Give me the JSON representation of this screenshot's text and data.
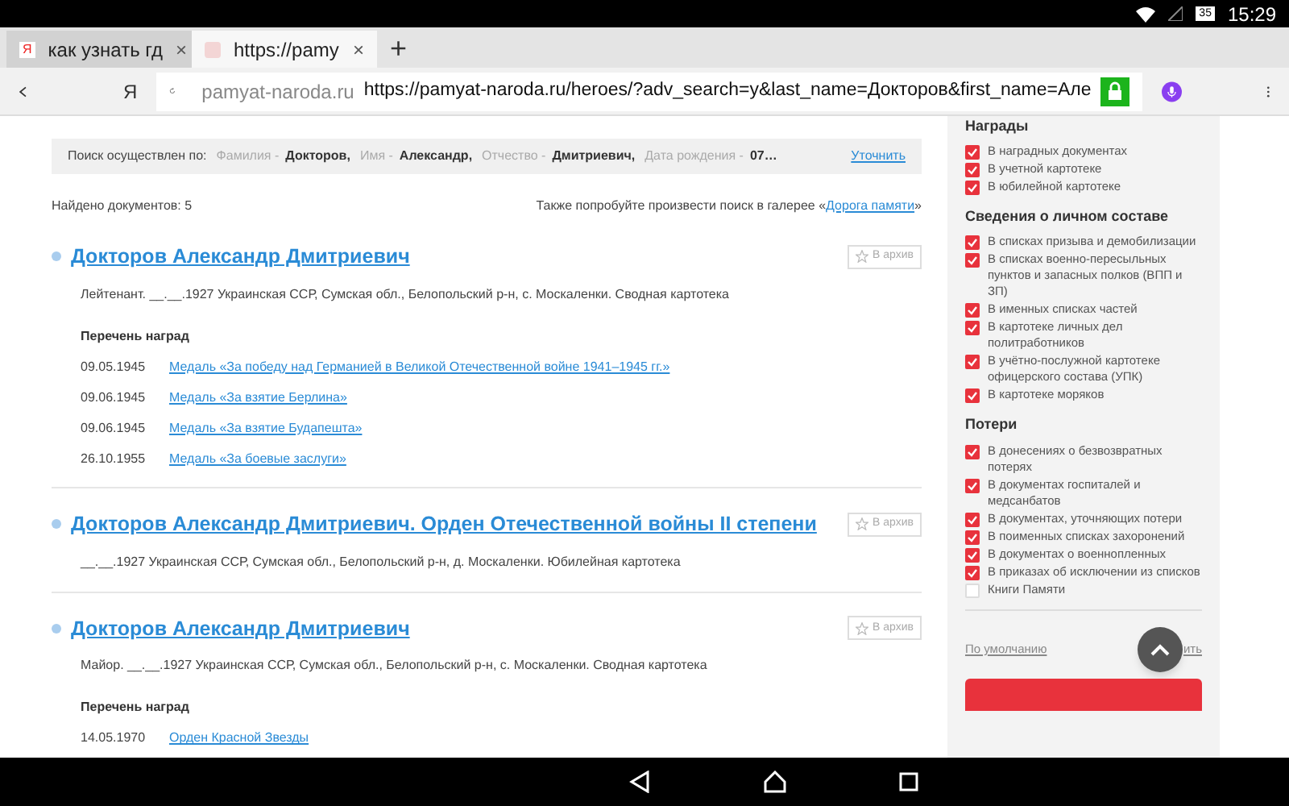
{
  "status_bar": {
    "battery": "35",
    "time": "15:29"
  },
  "tabs": [
    {
      "label": "как узнать гд",
      "selected": false,
      "favicon": "Я",
      "close": "×"
    },
    {
      "label": "https://pamy",
      "selected": true,
      "close": "×"
    }
  ],
  "new_tab": "+",
  "address_bar": {
    "logo": "Я",
    "domain": "pamyat-naroda.ru",
    "url": "https://pamyat-naroda.ru/heroes/?adv_search=y&last_name=Докторов&first_name=Але"
  },
  "search_summary": {
    "label": "Поиск осуществлен по:",
    "criteria": [
      {
        "field": "Фамилия -",
        "value": "Докторов,"
      },
      {
        "field": "Имя -",
        "value": "Александр,"
      },
      {
        "field": "Отчество -",
        "value": "Дмитриевич,"
      },
      {
        "field": "Дата рождения -",
        "value": "07…"
      }
    ],
    "link": "Уточнить"
  },
  "found": "Найдено документов: 5",
  "gallery_hint": {
    "text": "Также попробуйте произвести поиск в галерее «",
    "link": "Дорога памяти",
    "tail": "»"
  },
  "records": [
    {
      "title": "Докторов Александр Дмитриевич",
      "archive": "В архив",
      "description": "Лейтенант. __.__.1927 Украинская ССР, Сумская обл., Белопольский р-н, с. Москаленки. Сводная картотека",
      "awards_heading": "Перечень наград",
      "awards": [
        {
          "date": "09.05.1945",
          "name": "Медаль «За победу над Германией в Великой Отечественной войне 1941–1945 гг.»"
        },
        {
          "date": "09.06.1945",
          "name": "Медаль «За взятие Берлина»"
        },
        {
          "date": "09.06.1945",
          "name": "Медаль «За взятие Будапешта»"
        },
        {
          "date": "26.10.1955",
          "name": "Медаль «За боевые заслуги»"
        }
      ]
    },
    {
      "title": "Докторов Александр Дмитриевич. Орден Отечественной войны II степени",
      "archive": "В архив",
      "description": "__.__.1927 Украинская ССР, Сумская обл., Белопольский р-н, д. Москаленки. Юбилейная картотека"
    },
    {
      "title": "Докторов Александр Дмитриевич",
      "archive": "В архив",
      "description": "Майор. __.__.1927 Украинская ССР, Сумская обл., Белопольский р-н, с. Москаленки. Сводная картотека",
      "awards_heading": "Перечень наград",
      "awards": [
        {
          "date": "14.05.1970",
          "name": "Орден Красной Звезды"
        }
      ]
    }
  ],
  "filters": [
    {
      "heading": "Награды",
      "items": [
        {
          "label": "В наградных документах",
          "checked": true
        },
        {
          "label": "В учетной картотеке",
          "checked": true
        },
        {
          "label": "В юбилейной картотеке",
          "checked": true
        }
      ]
    },
    {
      "heading": "Сведения о личном составе",
      "items": [
        {
          "label": "В списках призыва и демобилизации",
          "checked": true
        },
        {
          "label": "В списках военно-пересыльных пунктов и запасных полков (ВПП и ЗП)",
          "checked": true
        },
        {
          "label": "В именных списках частей",
          "checked": true
        },
        {
          "label": "В картотеке личных дел политработников",
          "checked": true
        },
        {
          "label": "В учётно-послужной картотеке офицерского состава (УПК)",
          "checked": true
        },
        {
          "label": "В картотеке моряков",
          "checked": true
        }
      ]
    },
    {
      "heading": "Потери",
      "items": [
        {
          "label": "В донесениях о безвозвратных потерях",
          "checked": true
        },
        {
          "label": "В документах госпиталей и медсанбатов",
          "checked": true
        },
        {
          "label": "В документах, уточняющих потери",
          "checked": true
        },
        {
          "label": "В поименных списках захоронений",
          "checked": true
        },
        {
          "label": "В документах о военнопленных",
          "checked": true
        },
        {
          "label": "В приказах об исключении из списков",
          "checked": true
        },
        {
          "label": "Книги Памяти",
          "checked": false
        }
      ]
    }
  ],
  "default_link": "По умолчанию",
  "reset_link": "ить"
}
